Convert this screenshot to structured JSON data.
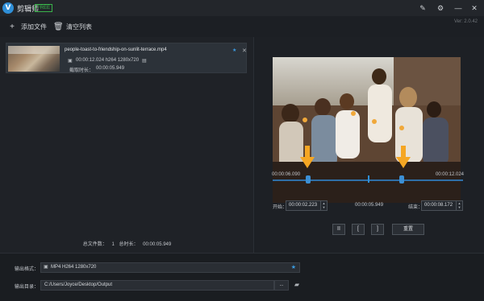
{
  "app": {
    "title": "剪辑师",
    "badge": "FREE",
    "logo_letter": "V",
    "version": "Ver: 2.0.42"
  },
  "titlebar_icons": [
    "feedback-icon",
    "settings-icon",
    "minimize-icon",
    "close-icon"
  ],
  "toolbar": {
    "add_file": "添加文件",
    "clear_list": "清空列表"
  },
  "file_list": {
    "items": [
      {
        "name": "people-toast-to-friendship-on-sunlit-terrace.mp4",
        "meta": "00:00:12.024 h264 1280x720",
        "duration_label": "截取时长：",
        "duration_value": "00:00:05.949"
      }
    ]
  },
  "summary": {
    "count_label": "总文件数：",
    "count_value": "1",
    "total_label": "总时长：",
    "total_value": "00:00:05.949"
  },
  "preview": {
    "time_current": "00:00:06.090",
    "time_total": "00:00:12.024",
    "start_label": "开始：",
    "start_value": "00:00:02.223",
    "segment_length": "00:00:05.949",
    "end_label": "结束：",
    "end_value": "00:00:08.172",
    "pause_label": "II",
    "mark_in_label": "[",
    "mark_out_label": "]",
    "reset_label": "重置",
    "trim_start_fraction": 0.185,
    "trim_end_fraction": 0.68,
    "playhead_fraction": 0.506
  },
  "output": {
    "format_label": "输出格式：",
    "format_value": "MP4 H264 1280x720",
    "dir_label": "输出目录：",
    "dir_value": "C:/Users/Joyce/Desktop/Output",
    "browse_label": "..."
  },
  "colors": {
    "accent": "#2f8fd8",
    "badge": "#39b34a",
    "arrow": "#f5a623"
  }
}
